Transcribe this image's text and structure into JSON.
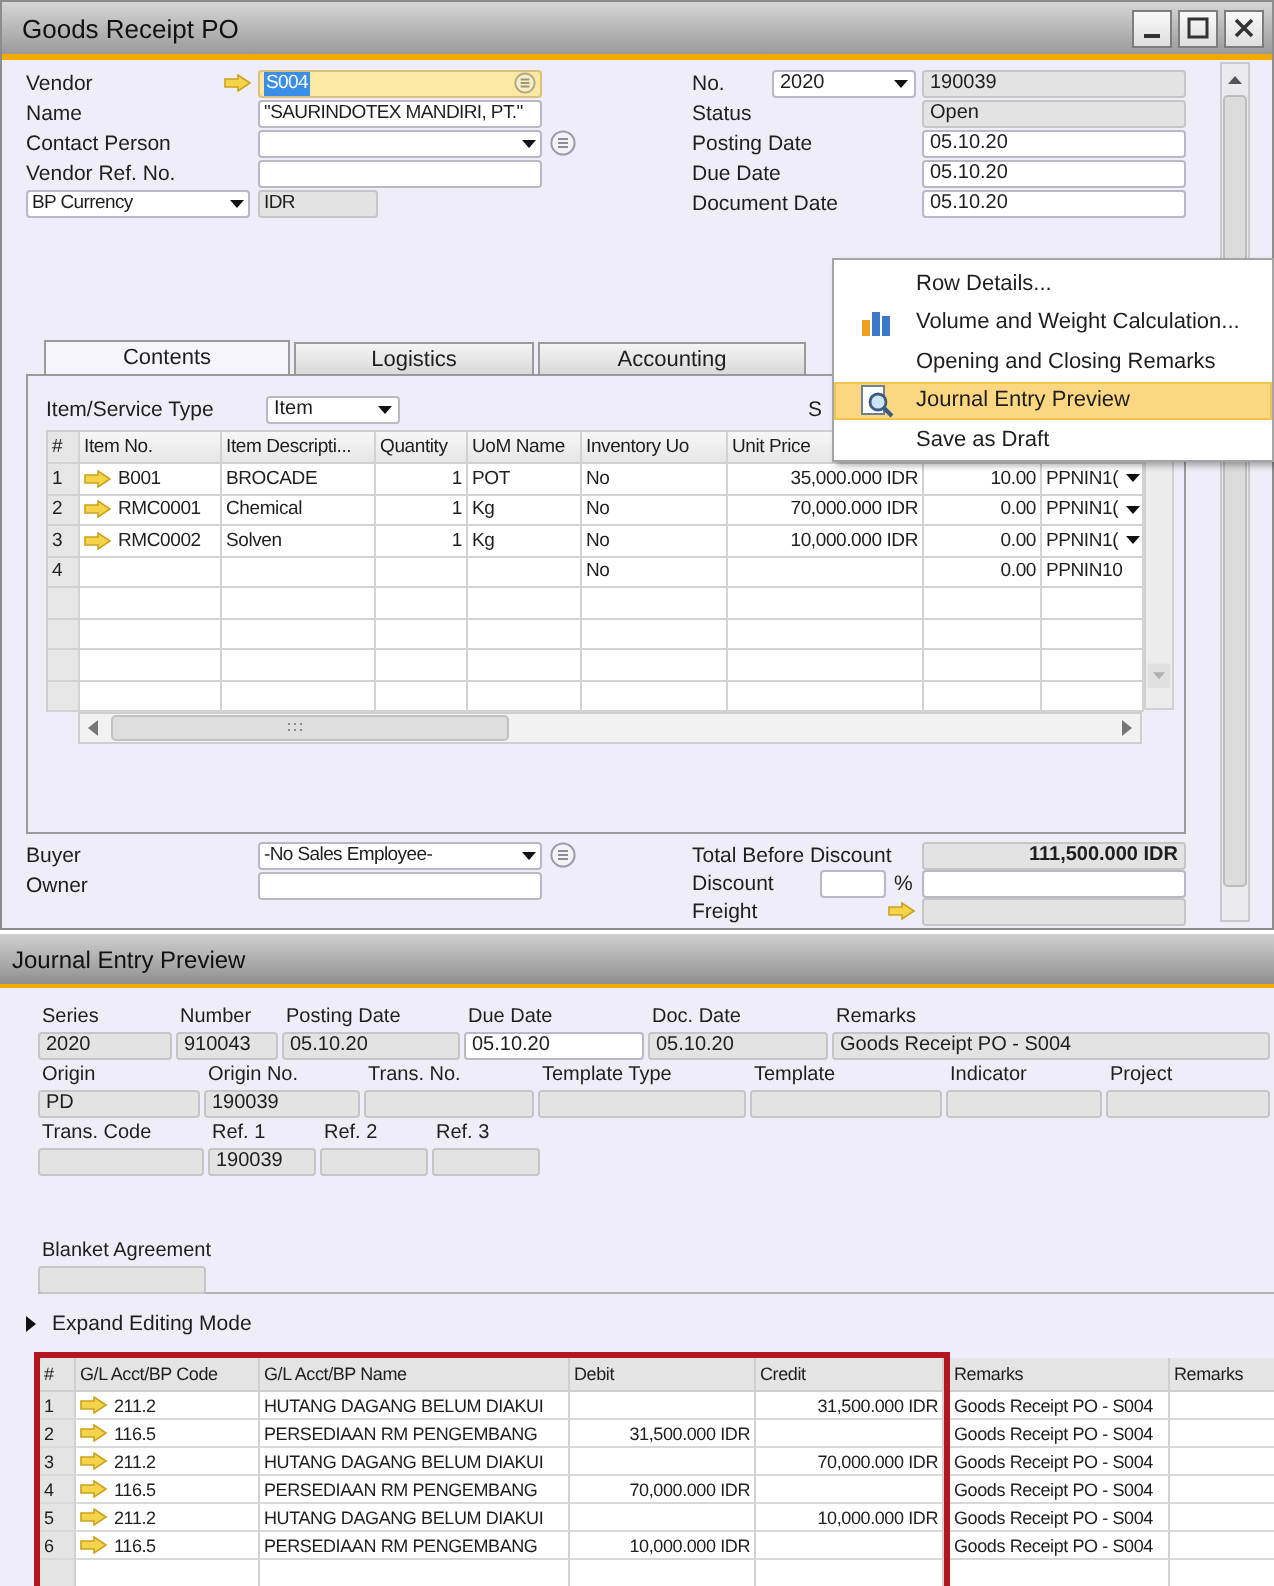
{
  "goods_receipt": {
    "title": "Goods Receipt PO",
    "header_left": [
      {
        "label": "Vendor",
        "kind": "search",
        "value": "S004",
        "value_selected": true,
        "info": false
      },
      {
        "label": "Name",
        "kind": "input",
        "value": "\"SAURINDOTEX MANDIRI, PT.\"",
        "info": false
      },
      {
        "label": "Contact Person",
        "kind": "dropdown",
        "info": true
      },
      {
        "label": "Vendor Ref. No.",
        "kind": "input",
        "info": false
      },
      {
        "label": "BP Currency",
        "kind": "label_dropdown",
        "value": "IDR",
        "info": false
      }
    ],
    "header_right": [
      {
        "label": "No.",
        "kind": "series",
        "series": "2020",
        "value": "190039"
      },
      {
        "label": "Status",
        "kind": "readonly",
        "value": "Open"
      },
      {
        "label": "Posting Date",
        "kind": "input",
        "value": "05.10.20"
      },
      {
        "label": "Due Date",
        "kind": "input",
        "value": "05.10.20"
      },
      {
        "label": "Document Date",
        "kind": "input",
        "value": "05.10.20"
      }
    ],
    "tabs": [
      {
        "label": "Contents",
        "selected": true
      },
      {
        "label": "Logistics",
        "selected": false
      },
      {
        "label": "Accounting",
        "selected": false
      }
    ],
    "item_service_type": {
      "label": "Item/Service Type",
      "value": "Item"
    },
    "cut_label": "S",
    "items_table": {
      "columns": [
        "#",
        "Item No.",
        "Item Descripti...",
        "Quantity",
        "UoM Name",
        "Inventory Uo",
        "Unit Price"
      ],
      "rows": [
        {
          "cells": [
            "1",
            "B001",
            "BROCADE",
            "1",
            "POT",
            "No",
            "35,000.000 IDR",
            "10.00",
            "PPNIN1("
          ],
          "tax_dropdown": true
        },
        {
          "cells": [
            "2",
            "RMC0001",
            "Chemical",
            "1",
            "Kg",
            "No",
            "70,000.000 IDR",
            "0.00",
            "PPNIN1("
          ],
          "tax_dropdown": true
        },
        {
          "cells": [
            "3",
            "RMC0002",
            "Solven",
            "1",
            "Kg",
            "No",
            "10,000.000 IDR",
            "0.00",
            "PPNIN1("
          ],
          "tax_dropdown": true
        },
        {
          "cells": [
            "4",
            null,
            null,
            null,
            null,
            "No",
            null,
            "0.00",
            "PPNIN10"
          ],
          "tax_dropdown": false
        }
      ]
    },
    "footer_left": [
      {
        "label": "Buyer",
        "kind": "dropdown",
        "value": "-No Sales Employee-",
        "info": true
      },
      {
        "label": "Owner",
        "kind": "input",
        "info": false
      }
    ],
    "totals": [
      {
        "label": "Total Before Discount",
        "kind": "readonly",
        "value": "111,500.000 IDR"
      },
      {
        "label": "Discount",
        "kind": "percent",
        "unit": "%"
      },
      {
        "label": "Freight",
        "kind": "link"
      }
    ]
  },
  "context_menu": {
    "items": [
      {
        "label": "Row Details...",
        "kind": "command",
        "selected": false
      },
      {
        "label": "Volume and Weight Calculation...",
        "kind": "calculation",
        "selected": false
      },
      {
        "label": "Opening and Closing Remarks",
        "kind": "command",
        "selected": false
      },
      {
        "label": "Journal Entry Preview",
        "kind": "preview",
        "selected": true
      },
      {
        "label": "Save as Draft",
        "kind": "command",
        "selected": false
      }
    ]
  },
  "journal_entry_preview": {
    "title": "Journal Entry Preview",
    "field_rows": [
      [
        {
          "label": "Series",
          "value": "2020",
          "editable": false
        },
        {
          "label": "Number",
          "value": "910043",
          "editable": false
        },
        {
          "label": "Posting Date",
          "value": "05.10.20",
          "editable": false
        },
        {
          "label": "Due Date",
          "value": "05.10.20",
          "editable": true
        },
        {
          "label": "Doc. Date",
          "value": "05.10.20",
          "editable": false
        },
        {
          "label": "Remarks",
          "value": "Goods Receipt PO - S004",
          "editable": false
        }
      ],
      [
        {
          "label": "Origin",
          "value": "PD",
          "editable": false
        },
        {
          "label": "Origin No.",
          "value": "190039",
          "editable": false
        },
        {
          "label": "Trans. No.",
          "editable": false
        },
        {
          "label": "Template Type",
          "editable": false
        },
        {
          "label": "Template",
          "editable": false
        },
        {
          "label": "Indicator",
          "editable": false
        },
        {
          "label": "Project",
          "editable": false
        }
      ],
      [
        {
          "label": "Trans. Code",
          "editable": false
        },
        {
          "label": "Ref. 1",
          "value": "190039",
          "editable": false
        },
        {
          "label": "Ref. 2",
          "editable": false
        },
        {
          "label": "Ref. 3",
          "editable": false
        }
      ],
      [
        {
          "label": "Blanket Agreement",
          "editable": false
        }
      ]
    ],
    "expand_editing_mode": {
      "label": "Expand Editing Mode",
      "expanded": false
    },
    "table": {
      "columns": [
        {
          "label": "#",
          "highlighted": true
        },
        {
          "label": "G/L Acct/BP Code",
          "highlighted": true
        },
        {
          "label": "G/L Acct/BP Name",
          "highlighted": true
        },
        {
          "label": "Debit",
          "highlighted": true
        },
        {
          "label": "Credit",
          "highlighted": true
        },
        {
          "label": "Remarks",
          "highlighted": false
        },
        {
          "label": "Remarks",
          "highlighted": false
        }
      ],
      "rows": [
        [
          "1",
          "211.2",
          "HUTANG DAGANG BELUM DIAKUI",
          null,
          "31,500.000 IDR",
          "Goods Receipt PO - S004",
          null
        ],
        [
          "2",
          "116.5",
          "PERSEDIAAN RM PENGEMBANG",
          "31,500.000 IDR",
          null,
          "Goods Receipt PO - S004",
          null
        ],
        [
          "3",
          "211.2",
          "HUTANG DAGANG BELUM DIAKUI",
          null,
          "70,000.000 IDR",
          "Goods Receipt PO - S004",
          null
        ],
        [
          "4",
          "116.5",
          "PERSEDIAAN RM PENGEMBANG",
          "70,000.000 IDR",
          null,
          "Goods Receipt PO - S004",
          null
        ],
        [
          "5",
          "211.2",
          "HUTANG DAGANG BELUM DIAKUI",
          null,
          "10,000.000 IDR",
          "Goods Receipt PO - S004",
          null
        ],
        [
          "6",
          "116.5",
          "PERSEDIAAN RM PENGEMBANG",
          "10,000.000 IDR",
          null,
          "Goods Receipt PO - S004",
          null
        ]
      ]
    }
  }
}
